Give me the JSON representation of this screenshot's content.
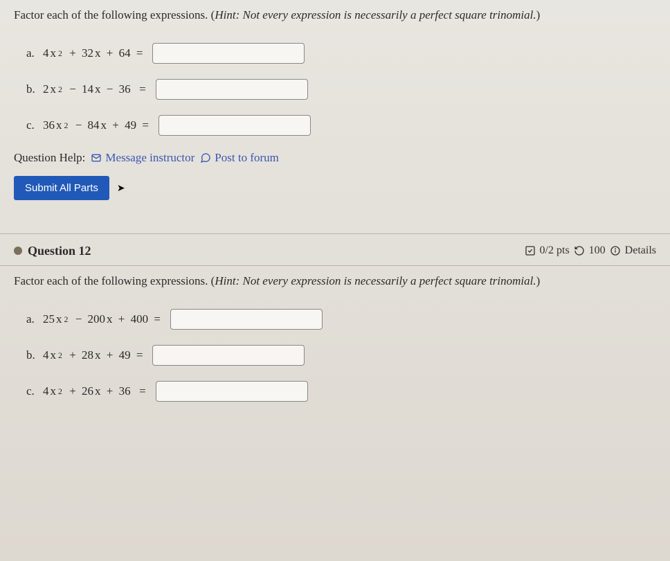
{
  "q11": {
    "prompt_start": "Factor each of the following expressions. (",
    "hint": "Hint: Not every expression is necessarily a perfect square trinomial.",
    "prompt_end": ")",
    "parts": {
      "a": {
        "label": "a.",
        "coef1": "4",
        "var1": "x",
        "sup1": "2",
        "op1": "+",
        "coef2": "32",
        "var2": "x",
        "op2": "+",
        "const": "64",
        "eq": "="
      },
      "b": {
        "label": "b.",
        "coef1": "2",
        "var1": "x",
        "sup1": "2",
        "op1": "−",
        "coef2": "14",
        "var2": "x",
        "op2": "−",
        "const": "36",
        "eq": "="
      },
      "c": {
        "label": "c.",
        "coef1": "36",
        "var1": "x",
        "sup1": "2",
        "op1": "−",
        "coef2": "84",
        "var2": "x",
        "op2": "+",
        "const": "49",
        "eq": "="
      }
    },
    "help": {
      "label": "Question Help:",
      "message": "Message instructor",
      "post": "Post to forum"
    },
    "submit": "Submit All Parts"
  },
  "q12": {
    "title": "Question 12",
    "score": "0/2 pts",
    "retries": "100",
    "details": "Details",
    "prompt_start": "Factor each of the following expressions. (",
    "hint": "Hint: Not every expression is necessarily a perfect square trinomial.",
    "prompt_end": ")",
    "parts": {
      "a": {
        "label": "a.",
        "coef1": "25",
        "var1": "x",
        "sup1": "2",
        "op1": "−",
        "coef2": "200",
        "var2": "x",
        "op2": "+",
        "const": "400",
        "eq": "="
      },
      "b": {
        "label": "b.",
        "coef1": "4",
        "var1": "x",
        "sup1": "2",
        "op1": "+",
        "coef2": "28",
        "var2": "x",
        "op2": "+",
        "const": "49",
        "eq": "="
      },
      "c": {
        "label": "c.",
        "coef1": "4",
        "var1": "x",
        "sup1": "2",
        "op1": "+",
        "coef2": "26",
        "var2": "x",
        "op2": "+",
        "const": "36",
        "eq": "="
      }
    }
  }
}
